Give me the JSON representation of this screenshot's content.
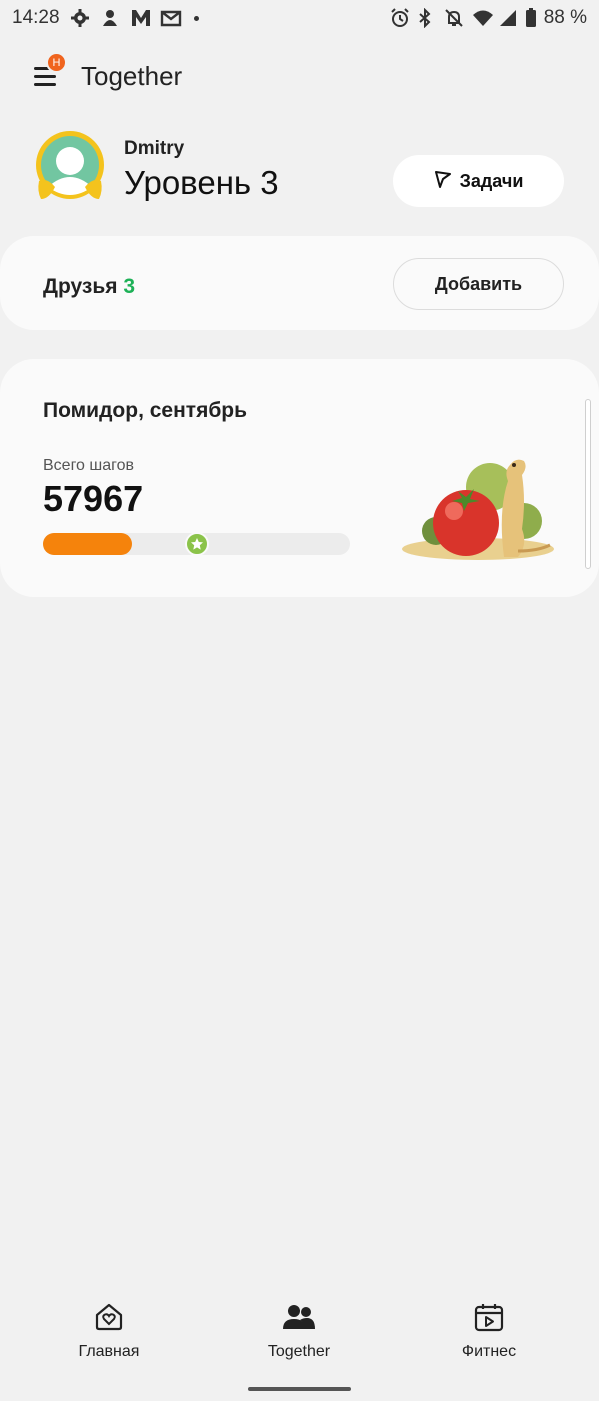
{
  "status_bar": {
    "time": "14:28",
    "battery": "88 %",
    "icons_left": [
      "settings-icon",
      "mascot-icon",
      "m-app-icon",
      "gmail-icon",
      "dot-icon"
    ],
    "icons_right": [
      "alarm-icon",
      "bluetooth-icon",
      "mute-icon",
      "wifi-icon",
      "signal-icon",
      "battery-icon"
    ]
  },
  "app_bar": {
    "title": "Together",
    "menu_badge": "H"
  },
  "profile": {
    "name": "Dmitry",
    "level": "Уровень 3",
    "tasks_label": "Задачи"
  },
  "friends": {
    "label": "Друзья",
    "count": "3",
    "add_label": "Добавить"
  },
  "challenge": {
    "title": "Помидор, сентябрь",
    "steps_label": "Всего шагов",
    "steps_value": "57967",
    "progress": 0.29,
    "milestone": 0.5
  },
  "nav": {
    "items": [
      {
        "label": "Главная",
        "icon": "home-heart-icon",
        "active": false
      },
      {
        "label": "Together",
        "icon": "people-icon",
        "active": true
      },
      {
        "label": "Фитнес",
        "icon": "calendar-play-icon",
        "active": false
      }
    ]
  },
  "colors": {
    "accent_orange": "#f5830c",
    "friends_green": "#1db157",
    "milestone_green": "#8bc34a",
    "badge_orange": "#f0641e"
  }
}
